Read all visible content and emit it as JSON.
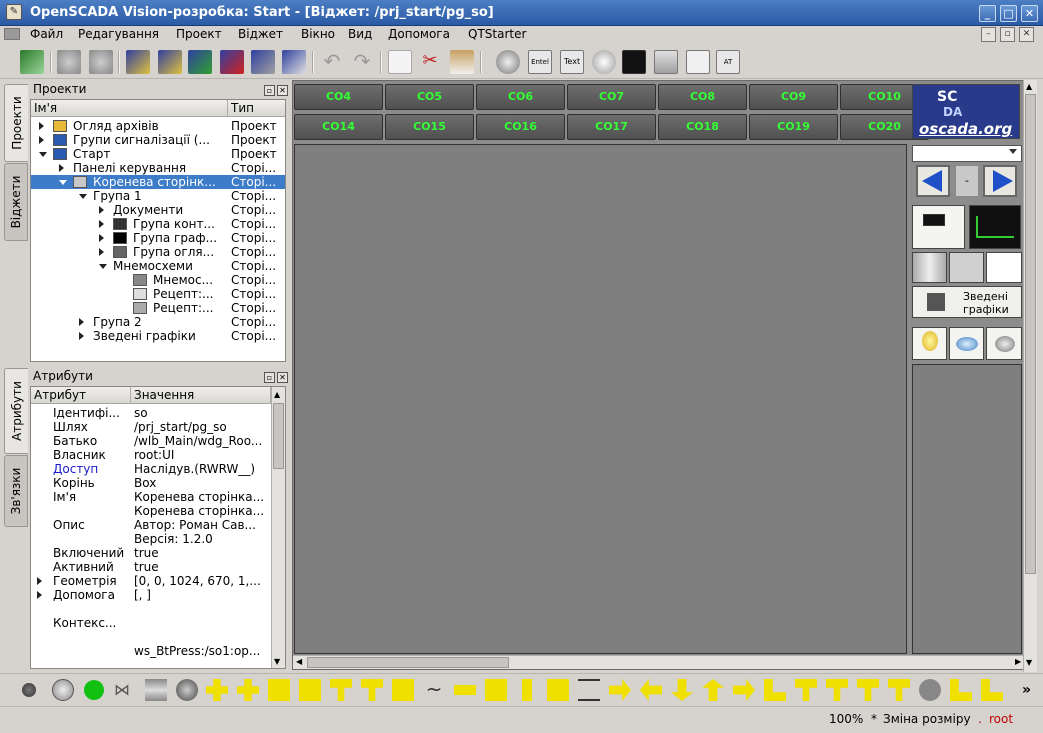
{
  "window": {
    "title": "OpenSCADA Vision-розробка: Start - [Віджет: /prj_start/pg_so]"
  },
  "menu": [
    "Файл",
    "Редагування",
    "Проект",
    "Віджет",
    "Вікно",
    "Вид",
    "Допомога",
    "QTStarter"
  ],
  "left_tabs_top": [
    "Проекти",
    "Віджети"
  ],
  "left_tabs_bottom": [
    "Атрибути",
    "Зв'язки"
  ],
  "projects": {
    "title": "Проекти",
    "col_name": "Ім'я",
    "col_type": "Тип",
    "rows": [
      {
        "name": "Огляд архівів",
        "type": "Проект"
      },
      {
        "name": "Групи сигналізації (...",
        "type": "Проект"
      },
      {
        "name": "Старт",
        "type": "Проект"
      },
      {
        "name": "Панелі керування",
        "type": "Сторі..."
      },
      {
        "name": "Коренева сторінк...",
        "type": "Сторі..."
      },
      {
        "name": "Група 1",
        "type": "Сторі..."
      },
      {
        "name": "Документи",
        "type": "Сторі..."
      },
      {
        "name": "Група конт...",
        "type": "Сторі..."
      },
      {
        "name": "Група граф...",
        "type": "Сторі..."
      },
      {
        "name": "Група огля...",
        "type": "Сторі..."
      },
      {
        "name": "Мнемосхеми",
        "type": "Сторі..."
      },
      {
        "name": "Мнемос...",
        "type": "Сторі..."
      },
      {
        "name": "Рецепт:...",
        "type": "Сторі..."
      },
      {
        "name": "Рецепт:...",
        "type": "Сторі..."
      },
      {
        "name": "Група 2",
        "type": "Сторі..."
      },
      {
        "name": "Зведені графіки",
        "type": "Сторі..."
      }
    ]
  },
  "attributes": {
    "title": "Атрибути",
    "col_attr": "Атрибут",
    "col_value": "Значення",
    "rows": [
      {
        "attr": "Ідентифі...",
        "value": "so"
      },
      {
        "attr": "Шлях",
        "value": "/prj_start/pg_so"
      },
      {
        "attr": "Батько",
        "value": "/wlb_Main/wdg_Roo..."
      },
      {
        "attr": "Власник",
        "value": "root:UI"
      },
      {
        "attr": "Доступ",
        "value": "Наслідув.(RWRW__)"
      },
      {
        "attr": "Корінь",
        "value": "Box"
      },
      {
        "attr": "Ім'я",
        "value": "Коренева сторінка..."
      },
      {
        "attr": "Опис",
        "value": "Коренева сторінка...",
        "value2": "Автор: Роман Сав...",
        "value3": "Версія: 1.2.0"
      },
      {
        "attr": "Включений",
        "value": "true"
      },
      {
        "attr": "Активний",
        "value": "true"
      },
      {
        "attr": "Геометрія",
        "value": "[0, 0, 1024, 670, 1,..."
      },
      {
        "attr": "Допомога",
        "value": "[, ]"
      },
      {
        "attr": "Контекс...",
        "value": ""
      },
      {
        "attr": "",
        "value": "ws_BtPress:/so1:op..."
      }
    ]
  },
  "co_buttons_row1": [
    "CO4",
    "CO5",
    "CO6",
    "CO7",
    "CO8",
    "CO9",
    "CO10"
  ],
  "co_buttons_row2": [
    "CO14",
    "CO15",
    "CO16",
    "CO17",
    "CO18",
    "CO19",
    "CO20"
  ],
  "logo": {
    "top": "SC",
    "mid": "DA",
    "url": "oscada.org"
  },
  "nav": {
    "middle": "-"
  },
  "summary_graphs": {
    "line1": "Зведені",
    "line2": "графіки"
  },
  "status": {
    "zoom": "100%",
    "modified": "*",
    "message": "Зміна розміру",
    "dot": ".",
    "user": "root"
  }
}
